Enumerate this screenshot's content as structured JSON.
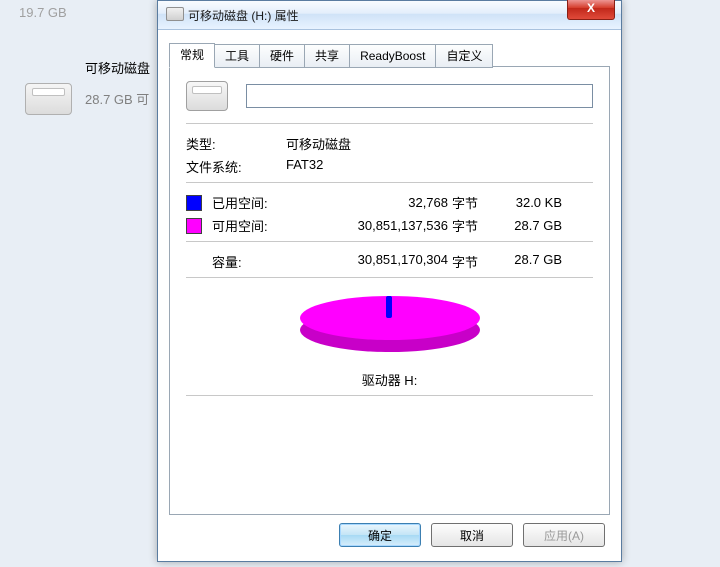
{
  "background": {
    "faint_size": "19.7 GB",
    "drive_name": "可移动磁盘",
    "drive_size": "28.7 GB 可"
  },
  "dialog": {
    "title": "可移动磁盘 (H:) 属性",
    "close_glyph": "X",
    "tabs": {
      "general": "常规",
      "tools": "工具",
      "hardware": "硬件",
      "sharing": "共享",
      "readyboost": "ReadyBoost",
      "customize": "自定义"
    },
    "name_value": "",
    "type_label": "类型:",
    "type_value": "可移动磁盘",
    "fs_label": "文件系统:",
    "fs_value": "FAT32",
    "used_label": "已用空间:",
    "used_bytes": "32,768",
    "free_label": "可用空间:",
    "free_bytes": "30,851,137,536",
    "bytes_unit": "字节",
    "used_human": "32.0 KB",
    "free_human": "28.7 GB",
    "capacity_label": "容量:",
    "capacity_bytes": "30,851,170,304",
    "capacity_human": "28.7 GB",
    "drive_caption": "驱动器 H:",
    "buttons": {
      "ok": "确定",
      "cancel": "取消",
      "apply": "应用(A)"
    }
  },
  "chart_data": {
    "type": "pie",
    "title": "驱动器 H:",
    "series": [
      {
        "name": "已用空间",
        "value": 32768,
        "human": "32.0 KB",
        "color": "#0000ff"
      },
      {
        "name": "可用空间",
        "value": 30851137536,
        "human": "28.7 GB",
        "color": "#ff00ff"
      }
    ],
    "total": {
      "name": "容量",
      "value": 30851170304,
      "human": "28.7 GB"
    }
  }
}
